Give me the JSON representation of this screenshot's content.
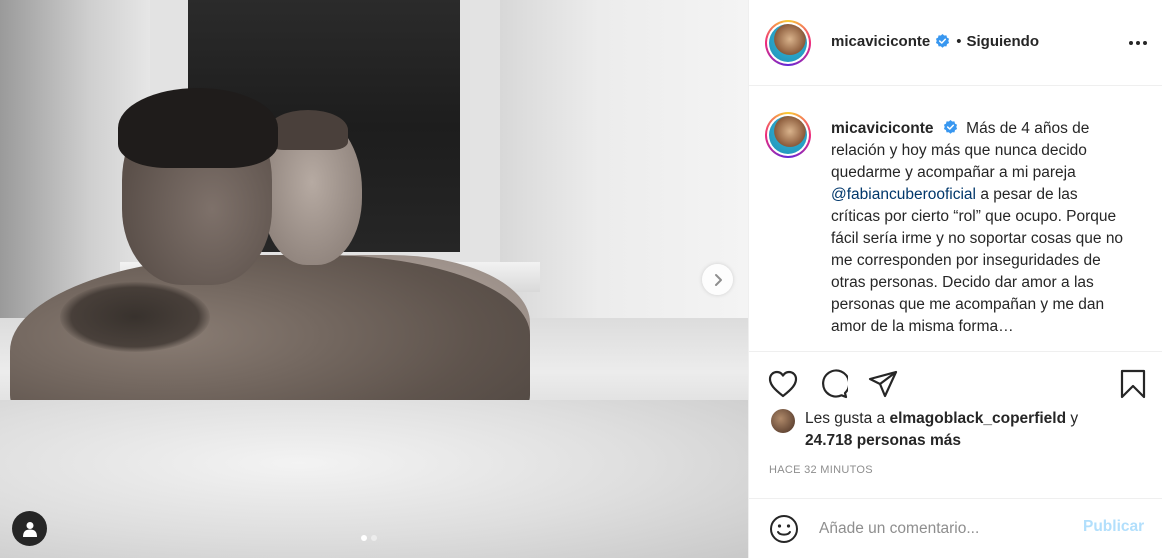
{
  "post": {
    "media": {
      "carousel": {
        "total": 2,
        "active_index": 0
      }
    },
    "header": {
      "username": "micaviciconte",
      "verified": true,
      "separator": "•",
      "follow_status": "Siguiendo"
    },
    "caption": {
      "username": "micaviciconte",
      "text_before_mention": "Más de 4 años de relación y hoy más que nunca decido quedarme y acompañar a mi pareja",
      "mention": "@fabiancuberooficial",
      "text_after_mention": "a pesar de las críticas por cierto “rol” que ocupo. Porque fácil sería irme y no soportar cosas que no me corresponden por inseguridades de otras personas. Decido dar amor a las personas que me acompañan y me dan amor de la misma forma…"
    },
    "likes": {
      "prefix": "Les gusta a",
      "liker": "elmagoblack_coperfield",
      "conjunction": "y",
      "others": "24.718 personas más"
    },
    "timestamp": "HACE 32 MINUTOS",
    "comment_box": {
      "placeholder": "Añade un comentario...",
      "publish_label": "Publicar"
    },
    "icons": {
      "like": "heart-icon",
      "comment": "comment-icon",
      "share": "share-icon",
      "save": "bookmark-icon",
      "emoji": "emoji-icon",
      "more": "more-options-icon",
      "next": "chevron-right-icon",
      "tags": "user-tag-icon"
    },
    "colors": {
      "mention": "#00376b",
      "verified": "#3897f0",
      "publish_disabled": "#b2dffc",
      "muted": "#8e8e8e"
    }
  }
}
